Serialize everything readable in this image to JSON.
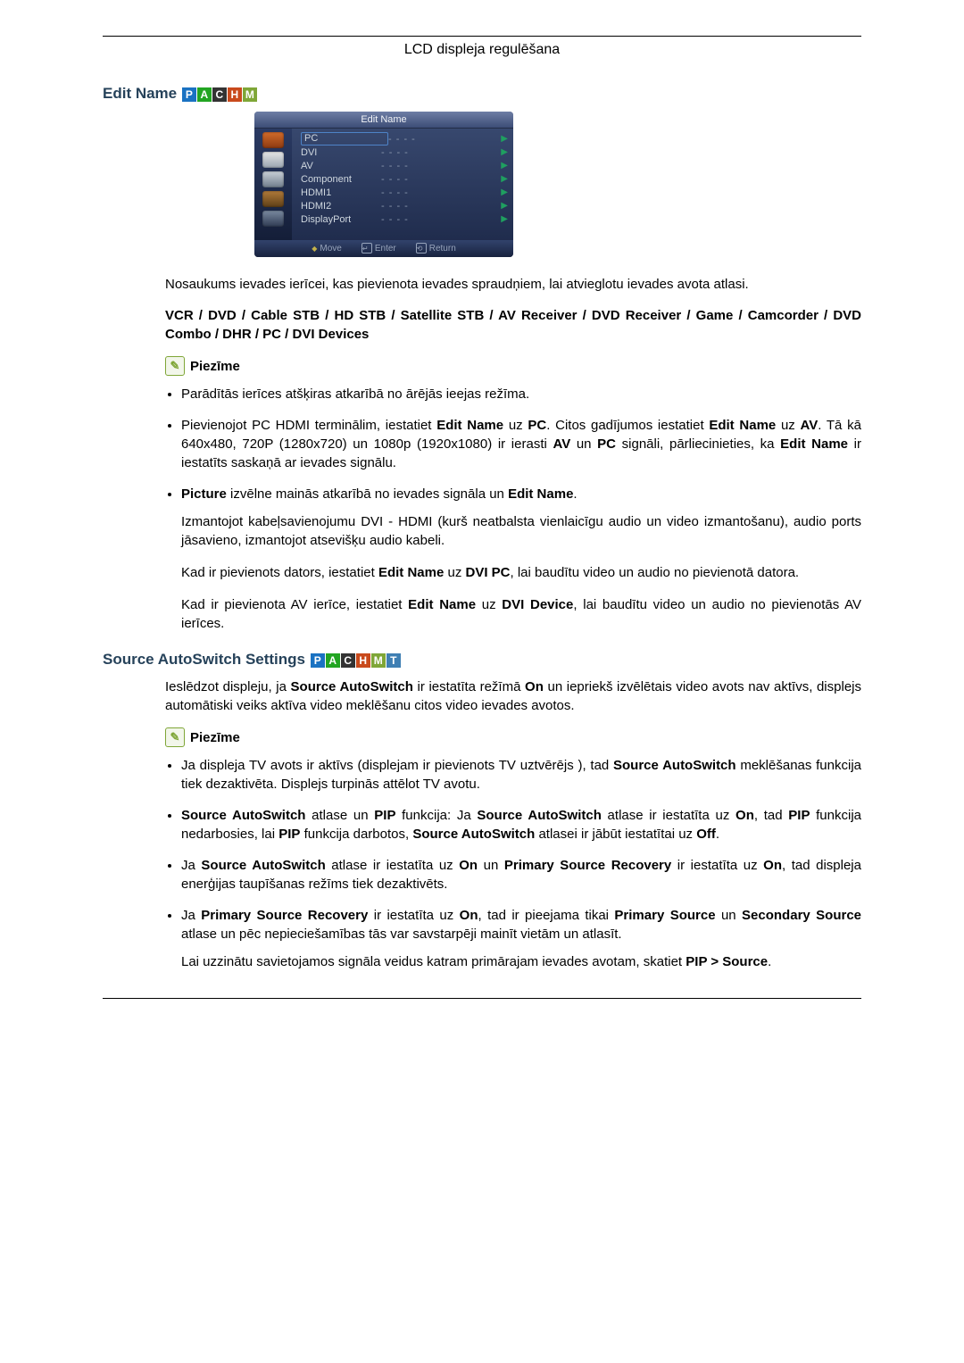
{
  "header": {
    "title": "LCD displeja regulēšana"
  },
  "badges": {
    "P": "P",
    "A": "A",
    "C": "C",
    "H": "H",
    "M": "M",
    "T": "T"
  },
  "section1": {
    "heading": "Edit Name",
    "menu": {
      "title": "Edit Name",
      "rows": [
        {
          "label": "PC",
          "value": "- - - -",
          "selected": true
        },
        {
          "label": "DVI",
          "value": "- - - -"
        },
        {
          "label": "AV",
          "value": "- - - -"
        },
        {
          "label": "Component",
          "value": "- - - -"
        },
        {
          "label": "HDMI1",
          "value": "- - - -"
        },
        {
          "label": "HDMI2",
          "value": "- - - -"
        },
        {
          "label": "DisplayPort",
          "value": "- - - -"
        }
      ],
      "footer": {
        "move": "Move",
        "enter": "Enter",
        "return": "Return"
      }
    },
    "intro": "Nosaukums ievades ierīcei, kas pievienota ievades spraudņiem, lai atvieglotu ievades avota atlasi.",
    "options": "VCR / DVD / Cable STB / HD STB / Satellite STB / AV Receiver / DVD Receiver / Game / Camcorder / DVD Combo / DHR / PC / DVI Devices",
    "note_label": "Piezīme",
    "bullets": {
      "b1": "Parādītās ierīces atšķiras atkarībā no ārējās ieejas režīma.",
      "b2_pre": "Pievienojot PC HDMI terminālim, iestatiet ",
      "b2_editName": "Edit Name",
      "b2_uz": " uz ",
      "b2_pc": "PC",
      "b2_mid1": ". Citos gadījumos iestatiet ",
      "b2_mid2": " uz ",
      "b2_av": "AV",
      "b2_mid3": ". Tā kā 640x480, 720P (1280x720) un 1080p (1920x1080) ir ierasti ",
      "b2_avb": "AV",
      "b2_un": " un ",
      "b2_pcb": "PC",
      "b2_mid4": " signāli, pārliecinieties, ka ",
      "b2_end": " ir iestatīts saskaņā ar ievades signālu.",
      "b3_pre": "",
      "b3_picture": "Picture",
      "b3_mid": " izvēlne mainās atkarībā no ievades signāla un ",
      "b3_end": ".",
      "b3_p1": "Izmantojot kabeļsavienojumu DVI - HDMI (kurš neatbalsta vienlaicīgu audio un video izmantošanu), audio ports jāsavieno, izmantojot atsevišķu audio kabeli.",
      "b3_p2_pre": "Kad ir pievienots dators, iestatiet ",
      "b3_p2_mid": " uz ",
      "b3_p2_dvipc": "DVI PC",
      "b3_p2_end": ", lai baudītu video un audio no pievienotā datora.",
      "b3_p3_pre": "Kad ir pievienota AV ierīce, iestatiet ",
      "b3_p3_mid": " uz ",
      "b3_p3_dvidev": "DVI Device",
      "b3_p3_end": ", lai baudītu video un audio no pievienotās AV ierīces."
    }
  },
  "section2": {
    "heading": "Source AutoSwitch Settings",
    "intro_pre": "Ieslēdzot displeju, ja ",
    "sas": "Source AutoSwitch",
    "intro_mid": " ir iestatīta režīmā ",
    "on": "On",
    "intro_end": " un iepriekš izvēlētais video avots nav aktīvs, displejs automātiski veiks aktīva video meklēšanu citos video ievades avotos.",
    "note_label": "Piezīme",
    "bullets": {
      "b1_pre": "Ja displeja TV avots ir aktīvs (displejam ir pievienots TV uztvērējs ), tad ",
      "b1_sas": "Source AutoSwitch",
      "b1_end": " meklēšanas funkcija tiek dezaktivēta. Displejs turpinās attēlot TV avotu.",
      "b2_pre": "",
      "b2_sas1": "Source AutoSwitch",
      "b2_mid1": " atlase un ",
      "b2_pip": "PIP",
      "b2_mid2": " funkcija: Ja ",
      "b2_mid3": " atlase ir iestatīta uz ",
      "b2_mid4": ", tad ",
      "b2_mid5": " funkcija nedarbosies, lai ",
      "b2_mid6": " funkcija darbotos, ",
      "b2_mid7": " atlasei ir jābūt iestatītai uz ",
      "b2_off": "Off",
      "b2_end": ".",
      "b3_pre": "Ja ",
      "b3_sas": "Source AutoSwitch",
      "b3_mid1": " atlase ir iestatīta uz ",
      "b3_mid1b": " un ",
      "b3_psr": "Primary Source Recovery",
      "b3_mid2": " ir iestatīta uz ",
      "b3_end": ", tad displeja enerģijas taupīšanas režīms tiek dezaktivēts.",
      "b4_pre": "Ja ",
      "b4_psr": "Primary Source Recovery",
      "b4_mid1": " ir iestatīta uz ",
      "b4_mid2": ", tad ir pieejama tikai ",
      "b4_ps": "Primary Source",
      "b4_un": " un ",
      "b4_ss": "Secondary Source",
      "b4_end": " atlase un pēc nepieciešamības tās var savstarpēji mainīt vietām un atlasīt.",
      "b4_p2_pre": "Lai uzzinātu savietojamos signāla veidus katram primārajam ievades avotam, skatiet ",
      "b4_p2_pips": "PIP > Source",
      "b4_p2_end": "."
    }
  }
}
